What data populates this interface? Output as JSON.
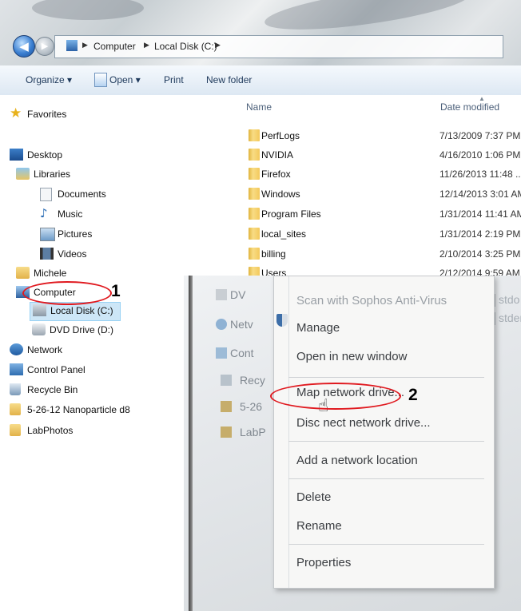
{
  "address_bar": {
    "crumbs": [
      "Computer",
      "Local Disk (C:)"
    ]
  },
  "toolbar": {
    "organize": "Organize ▾",
    "open": "Open ▾",
    "print": "Print",
    "new_folder": "New folder"
  },
  "sidebar": {
    "favorites": "Favorites",
    "desktop": "Desktop",
    "libraries": "Libraries",
    "documents": "Documents",
    "music": "Music",
    "pictures": "Pictures",
    "videos": "Videos",
    "user": "Michele",
    "computer": "Computer",
    "local_disk": "Local Disk (C:)",
    "dvd_drive": "DVD Drive (D:)",
    "network": "Network",
    "control_panel": "Control Panel",
    "recycle_bin": "Recycle Bin",
    "folder1": "5-26-12 Nanoparticle d8",
    "folder2": "LabPhotos"
  },
  "files": {
    "col_name": "Name",
    "col_date": "Date modified",
    "rows": [
      {
        "name": "PerfLogs",
        "date": "7/13/2009 7:37 PM"
      },
      {
        "name": "NVIDIA",
        "date": "4/16/2010 1:06 PM"
      },
      {
        "name": "Firefox",
        "date": "11/26/2013 11:48 ..."
      },
      {
        "name": "Windows",
        "date": "12/14/2013 3:01 AM"
      },
      {
        "name": "Program Files",
        "date": "1/31/2014 11:41 AM"
      },
      {
        "name": "local_sites",
        "date": "1/31/2014 2:19 PM"
      },
      {
        "name": "billing",
        "date": "2/10/2014 3:25 PM"
      },
      {
        "name": "Users",
        "date": "2/12/2014 9:59 AM"
      }
    ]
  },
  "photo_bg": {
    "items": [
      "DV",
      "Netv",
      "Cont",
      "Recy",
      "5-26",
      "LabP"
    ],
    "right_1": "stdo",
    "right_2": "stder"
  },
  "context_menu": {
    "scan": "Scan with Sophos Anti-Virus",
    "manage": "Manage",
    "open_new": "Open in new window",
    "map_drive": "Map network drive...",
    "disconnect": "Disc nect network drive...",
    "add_location": "Add a network location",
    "delete": "Delete",
    "rename": "Rename",
    "properties": "Properties"
  },
  "annotations": {
    "step1": "1",
    "step2": "2"
  },
  "colors": {
    "annotation_ring": "#e0191f",
    "selection": "#cde6f7",
    "folder": "#f3c95c"
  }
}
